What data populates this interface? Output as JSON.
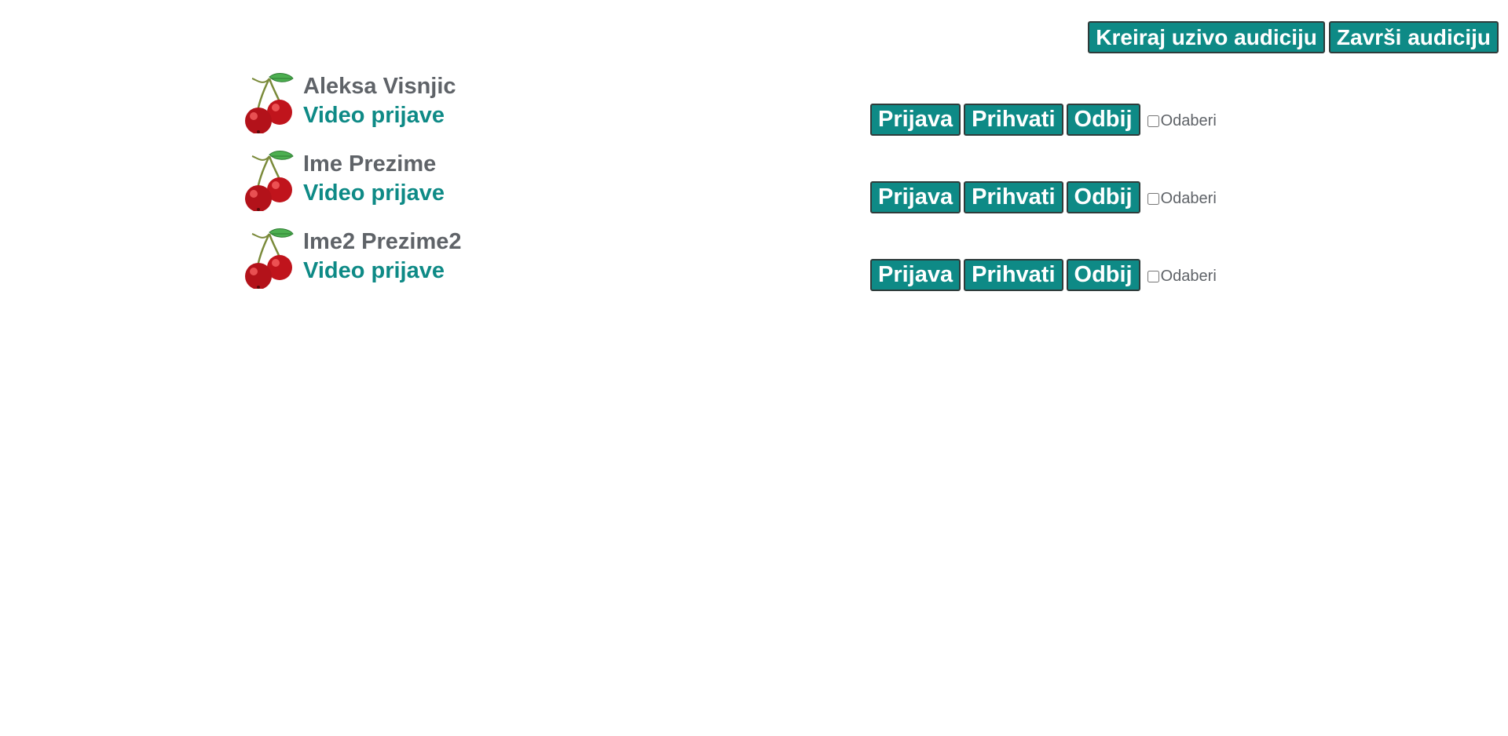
{
  "header": {
    "create_live_label": "Kreiraj uzivo audiciju",
    "finish_label": "Završi audiciju"
  },
  "candidates": [
    {
      "name": "Aleksa Visnjic",
      "video_link": "Video prijave",
      "apply_label": "Prijava",
      "accept_label": "Prihvati",
      "reject_label": "Odbij",
      "select_label": "Odaberi",
      "selected": false
    },
    {
      "name": "Ime Prezime",
      "video_link": "Video prijave",
      "apply_label": "Prijava",
      "accept_label": "Prihvati",
      "reject_label": "Odbij",
      "select_label": "Odaberi",
      "selected": false
    },
    {
      "name": "Ime2 Prezime2",
      "video_link": "Video prijave",
      "apply_label": "Prijava",
      "accept_label": "Prihvati",
      "reject_label": "Odbij",
      "select_label": "Odaberi",
      "selected": false
    }
  ],
  "icons": {
    "avatar": "cherry-icon"
  },
  "colors": {
    "accent": "#0e8a86",
    "text_gray": "#5f6368",
    "button_border": "#2e3b3a"
  }
}
